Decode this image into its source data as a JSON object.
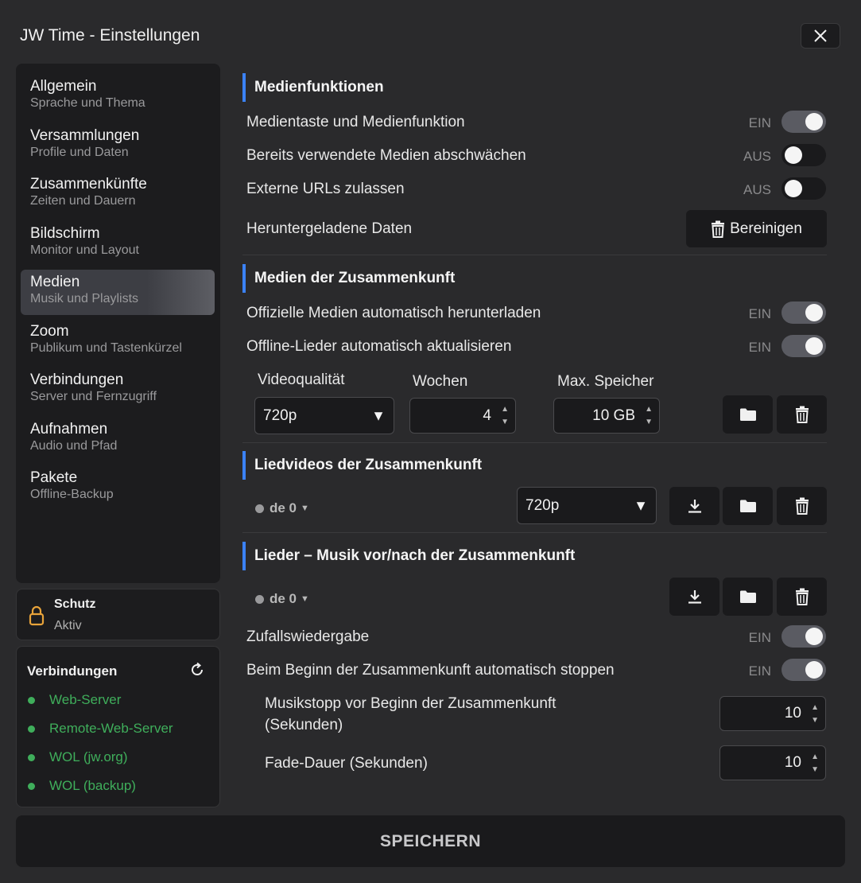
{
  "window": {
    "title": "JW Time - Einstellungen"
  },
  "sidebar": {
    "items": [
      {
        "label": "Allgemein",
        "sub": "Sprache und Thema"
      },
      {
        "label": "Versammlungen",
        "sub": "Profile und Daten"
      },
      {
        "label": "Zusammenkünfte",
        "sub": "Zeiten und Dauern"
      },
      {
        "label": "Bildschirm",
        "sub": "Monitor und Layout"
      },
      {
        "label": "Medien",
        "sub": "Musik und Playlists",
        "active": true
      },
      {
        "label": "Zoom",
        "sub": "Publikum und Tastenkürzel"
      },
      {
        "label": "Verbindungen",
        "sub": "Server und Fernzugriff"
      },
      {
        "label": "Aufnahmen",
        "sub": "Audio und Pfad"
      },
      {
        "label": "Pakete",
        "sub": "Offline-Backup"
      }
    ],
    "protection": {
      "title": "Schutz",
      "status": "Aktiv"
    },
    "connections": {
      "title": "Verbindungen",
      "items": [
        "Web-Server",
        "Remote-Web-Server",
        "WOL (jw.org)",
        "WOL (backup)"
      ],
      "status_color": "#3fae5b"
    }
  },
  "media_functions": {
    "heading": "Medienfunktionen",
    "media_key": {
      "label": "Medientaste und Medienfunktion",
      "state": "EIN"
    },
    "dim_used": {
      "label": "Bereits verwendete Medien abschwächen",
      "state": "AUS"
    },
    "external_urls": {
      "label": "Externe URLs zulassen",
      "state": "AUS"
    },
    "downloaded_data": {
      "label": "Heruntergeladene Daten",
      "button": "Bereinigen"
    }
  },
  "meeting_media": {
    "heading": "Medien der Zusammenkunft",
    "auto_download": {
      "label": "Offizielle Medien automatisch herunterladen",
      "state": "EIN"
    },
    "auto_update": {
      "label": "Offline-Lieder automatisch aktualisieren",
      "state": "EIN"
    },
    "video_quality": {
      "label": "Videoqualität",
      "value": "720p"
    },
    "weeks": {
      "label": "Wochen",
      "value": "4"
    },
    "max_storage": {
      "label": "Max. Speicher",
      "value": "10 GB"
    }
  },
  "song_videos": {
    "heading": "Liedvideos der Zusammenkunft",
    "lang": "de 0",
    "quality": "720p"
  },
  "songs_music": {
    "heading": "Lieder – Musik vor/nach der Zusammenkunft",
    "lang": "de 0",
    "shuffle": {
      "label": "Zufallswiedergabe",
      "state": "EIN"
    },
    "auto_stop": {
      "label": "Beim Beginn der Zusammenkunft automatisch stoppen",
      "state": "EIN"
    },
    "stop_before": {
      "label_line1": "Musikstopp vor Beginn der Zusammenkunft",
      "label_line2": "(Sekunden)",
      "value": "10"
    },
    "fade": {
      "label": "Fade-Dauer (Sekunden)",
      "value": "10"
    }
  },
  "footer": {
    "save": "SPEICHERN"
  },
  "colors": {
    "accent": "#3b82f6",
    "background": "#2a2a2c",
    "panel": "#1c1c1e"
  }
}
